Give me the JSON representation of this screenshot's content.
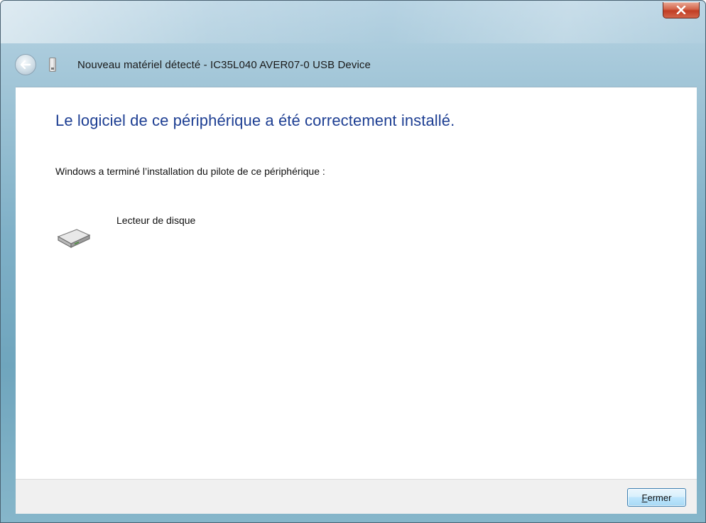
{
  "window": {
    "title": "Nouveau matériel détecté - IC35L040 AVER07-0 USB Device",
    "close_icon": "close-x-icon"
  },
  "nav": {
    "back_icon": "back-arrow-icon",
    "device_icon": "usb-device-icon"
  },
  "content": {
    "heading": "Le logiciel de ce périphérique a été correctement installé.",
    "body": "Windows a terminé l’installation du pilote de ce périphérique :",
    "device": {
      "icon": "disk-drive-icon",
      "name": "Lecteur de disque"
    }
  },
  "footer": {
    "close_button": {
      "mnemonic": "F",
      "rest": "ermer"
    }
  },
  "colors": {
    "heading": "#1e3f93",
    "close_red": "#c13d24",
    "button_border": "#3c7fb1"
  }
}
